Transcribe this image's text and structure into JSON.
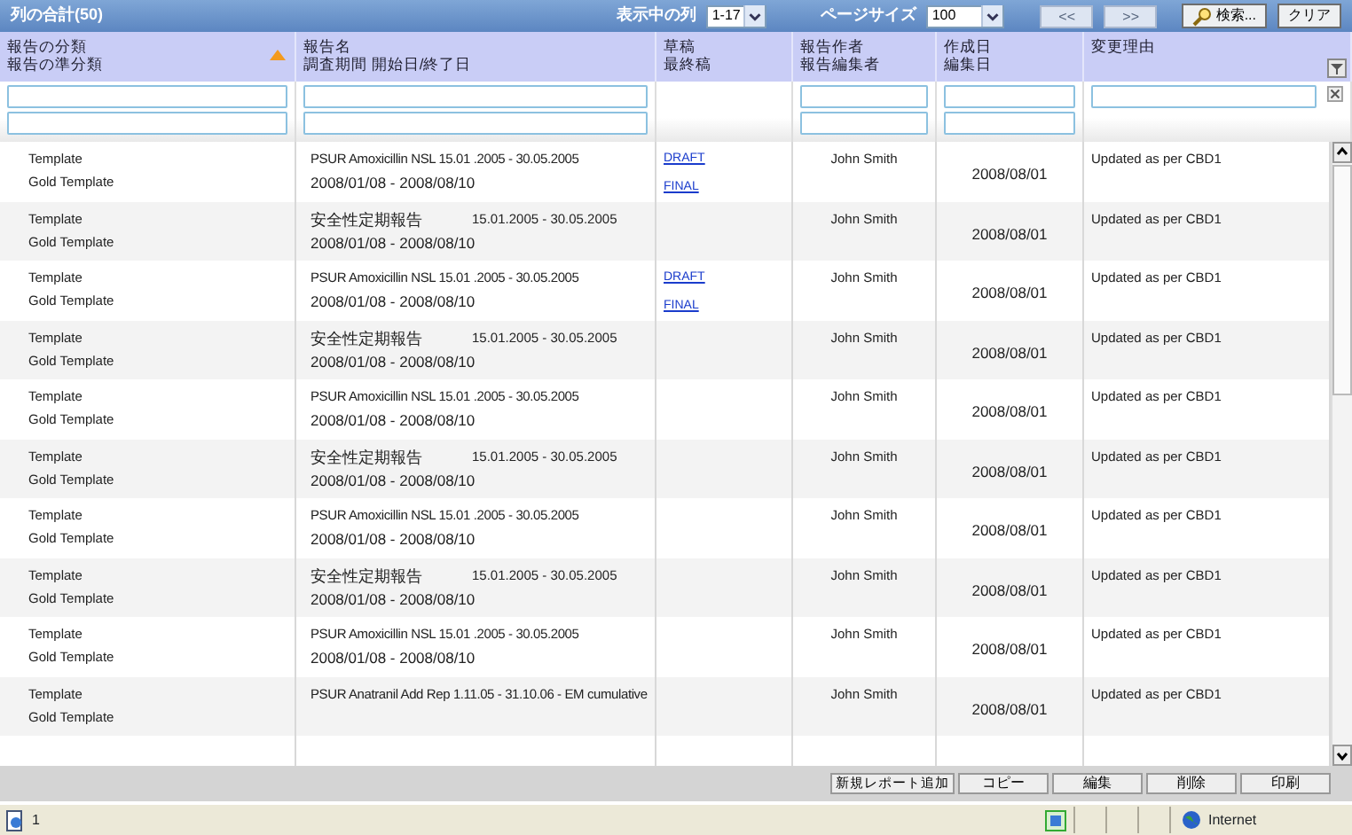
{
  "title": "列の合計(50)",
  "toolbar": {
    "visible_columns_label": "表示中の列",
    "visible_columns": "1-17",
    "page_size_label": "ページサイズ",
    "page_size": "100",
    "prev": {
      "label": "<<",
      "disabled": true
    },
    "next": {
      "label": ">>",
      "disabled": true
    },
    "search": "検索...",
    "clear": "クリア"
  },
  "columns": [
    {
      "line1": "報告の分類",
      "line2": "報告の準分類",
      "sorted": true,
      "filters": [
        {
          "kind": "input"
        },
        {
          "kind": "input"
        }
      ]
    },
    {
      "line1": "報告名",
      "line2": "調査期間 開始日/終了日",
      "sorted": false,
      "filters": [
        {
          "kind": "input"
        },
        {
          "kind": "input"
        }
      ]
    },
    {
      "line1": "草稿",
      "line2": "最終稿",
      "sorted": false
    },
    {
      "line1": "報告作者",
      "line2": "報告編集者",
      "sorted": false,
      "filters": [
        {
          "kind": "input"
        },
        {
          "kind": "input"
        }
      ]
    },
    {
      "line1": "作成日",
      "line2": "編集日",
      "sorted": false,
      "filters": [
        {
          "kind": "input"
        },
        {
          "kind": "input"
        }
      ]
    },
    {
      "line1": "変更理由",
      "sorted": false,
      "filters": [
        {
          "kind": "input"
        }
      ]
    }
  ],
  "rows": [
    {
      "category": "Template",
      "subcategory": "Gold Template",
      "name": "PSUR Amoxicillin NSL 15.01 .2005 - 30.05.2005",
      "dates": "2008/01/08 - 2008/08/10",
      "links": [
        "DRAFT",
        "FINAL"
      ],
      "author": "John Smith",
      "date": "2008/08/01",
      "reason": "Updated as per CBD1"
    },
    {
      "category": "Template",
      "subcategory": "Gold Template",
      "name": "安全性定期報告",
      "period": "15.01.2005 - 30.05.2005",
      "dates": "2008/01/08 - 2008/08/10",
      "author": "John Smith",
      "date": "2008/08/01",
      "reason": "Updated as per CBD1"
    },
    {
      "category": "Template",
      "subcategory": "Gold Template",
      "name": "PSUR Amoxicillin NSL 15.01 .2005 - 30.05.2005",
      "dates": "2008/01/08 - 2008/08/10",
      "links": [
        "DRAFT",
        "FINAL"
      ],
      "author": "John Smith",
      "date": "2008/08/01",
      "reason": "Updated as per CBD1"
    },
    {
      "category": "Template",
      "subcategory": "Gold Template",
      "name": "安全性定期報告",
      "period": "15.01.2005 - 30.05.2005",
      "dates": "2008/01/08 - 2008/08/10",
      "author": "John Smith",
      "date": "2008/08/01",
      "reason": "Updated as per CBD1"
    },
    {
      "category": "Template",
      "subcategory": "Gold Template",
      "name": "PSUR Amoxicillin NSL 15.01 .2005 - 30.05.2005",
      "dates": "2008/01/08 - 2008/08/10",
      "author": "John Smith",
      "date": "2008/08/01",
      "reason": "Updated as per CBD1"
    },
    {
      "category": "Template",
      "subcategory": "Gold Template",
      "name": "安全性定期報告",
      "period": "15.01.2005 - 30.05.2005",
      "dates": "2008/01/08 - 2008/08/10",
      "author": "John Smith",
      "date": "2008/08/01",
      "reason": "Updated as per CBD1"
    },
    {
      "category": "Template",
      "subcategory": "Gold Template",
      "name": "PSUR Amoxicillin NSL 15.01 .2005 - 30.05.2005",
      "dates": "2008/01/08 - 2008/08/10",
      "author": "John Smith",
      "date": "2008/08/01",
      "reason": "Updated as per CBD1"
    },
    {
      "category": "Template",
      "subcategory": "Gold Template",
      "name": "安全性定期報告",
      "period": "15.01.2005 - 30.05.2005",
      "dates": "2008/01/08 - 2008/08/10",
      "author": "John Smith",
      "date": "2008/08/01",
      "reason": "Updated as per CBD1"
    },
    {
      "category": "Template",
      "subcategory": "Gold Template",
      "name": "PSUR Amoxicillin NSL 15.01 .2005 - 30.05.2005",
      "dates": "2008/01/08 - 2008/08/10",
      "author": "John Smith",
      "date": "2008/08/01",
      "reason": "Updated as per CBD1"
    },
    {
      "category": "Template",
      "subcategory": "Gold Template",
      "name": "PSUR Anatranil Add Rep 1.11.05 - 31.10.06 - EM cumulative",
      "author": "John Smith",
      "date": "2008/08/01",
      "reason": "Updated as per CBD1"
    }
  ],
  "actions": [
    "新規レポート追加",
    "コピー",
    "編集",
    "削除",
    "印刷"
  ],
  "status_bar": {
    "page": "1",
    "zone": "Internet"
  }
}
